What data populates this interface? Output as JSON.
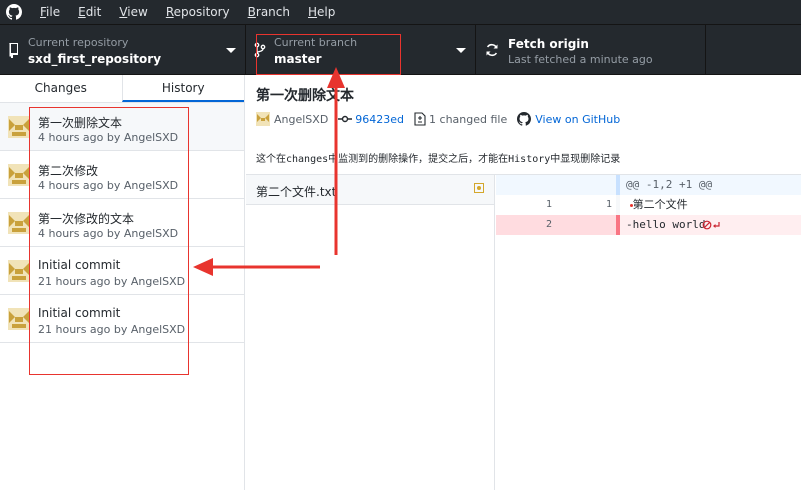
{
  "menubar": {
    "items": [
      {
        "key": "F",
        "rest": "ile"
      },
      {
        "key": "E",
        "rest": "dit"
      },
      {
        "key": "V",
        "rest": "iew"
      },
      {
        "key": "R",
        "rest": "epository"
      },
      {
        "key": "B",
        "rest": "ranch"
      },
      {
        "key": "H",
        "rest": "elp"
      }
    ]
  },
  "toolbar": {
    "repo_label": "Current repository",
    "repo_value": "sxd_first_repository",
    "branch_label": "Current branch",
    "branch_value": "master",
    "fetch_label": "Fetch origin",
    "fetch_value": "Last fetched a minute ago"
  },
  "sidebar": {
    "tabs": [
      {
        "label": "Changes",
        "active": false
      },
      {
        "label": "History",
        "active": true
      }
    ],
    "commits": [
      {
        "title": "第一次删除文本",
        "meta": "4 hours ago by AngelSXD",
        "selected": true
      },
      {
        "title": "第二次修改",
        "meta": "4 hours ago by AngelSXD",
        "selected": false
      },
      {
        "title": "第一次修改的文本",
        "meta": "4 hours ago by AngelSXD",
        "selected": false
      },
      {
        "title": "Initial commit",
        "meta": "21 hours ago by AngelSXD",
        "selected": false
      },
      {
        "title": "Initial commit",
        "meta": "21 hours ago by AngelSXD",
        "selected": false
      }
    ]
  },
  "commit": {
    "title": "第一次删除文本",
    "author": "AngelSXD",
    "sha": "96423ed",
    "changed_files": "1 changed file",
    "view_on_github": "View on GitHub",
    "description": "这个在changes中监测到的删除操作，提交之后，才能在History中显现删除记录"
  },
  "files": [
    {
      "name": "第二个文件.txt",
      "status": "modified"
    }
  ],
  "diff": [
    {
      "type": "hunk",
      "old": "",
      "new": "",
      "text": "@@ -1,2 +1 @@"
    },
    {
      "type": "ctx",
      "old": "1",
      "new": "1",
      "text": " 第二个文件"
    },
    {
      "type": "del",
      "old": "2",
      "new": "",
      "text": "-hello world"
    }
  ],
  "colors": {
    "accent": "#0366d6",
    "annotation": "#e8342e",
    "avatar": "#c9a13c",
    "deleted": "#ffeef0"
  }
}
